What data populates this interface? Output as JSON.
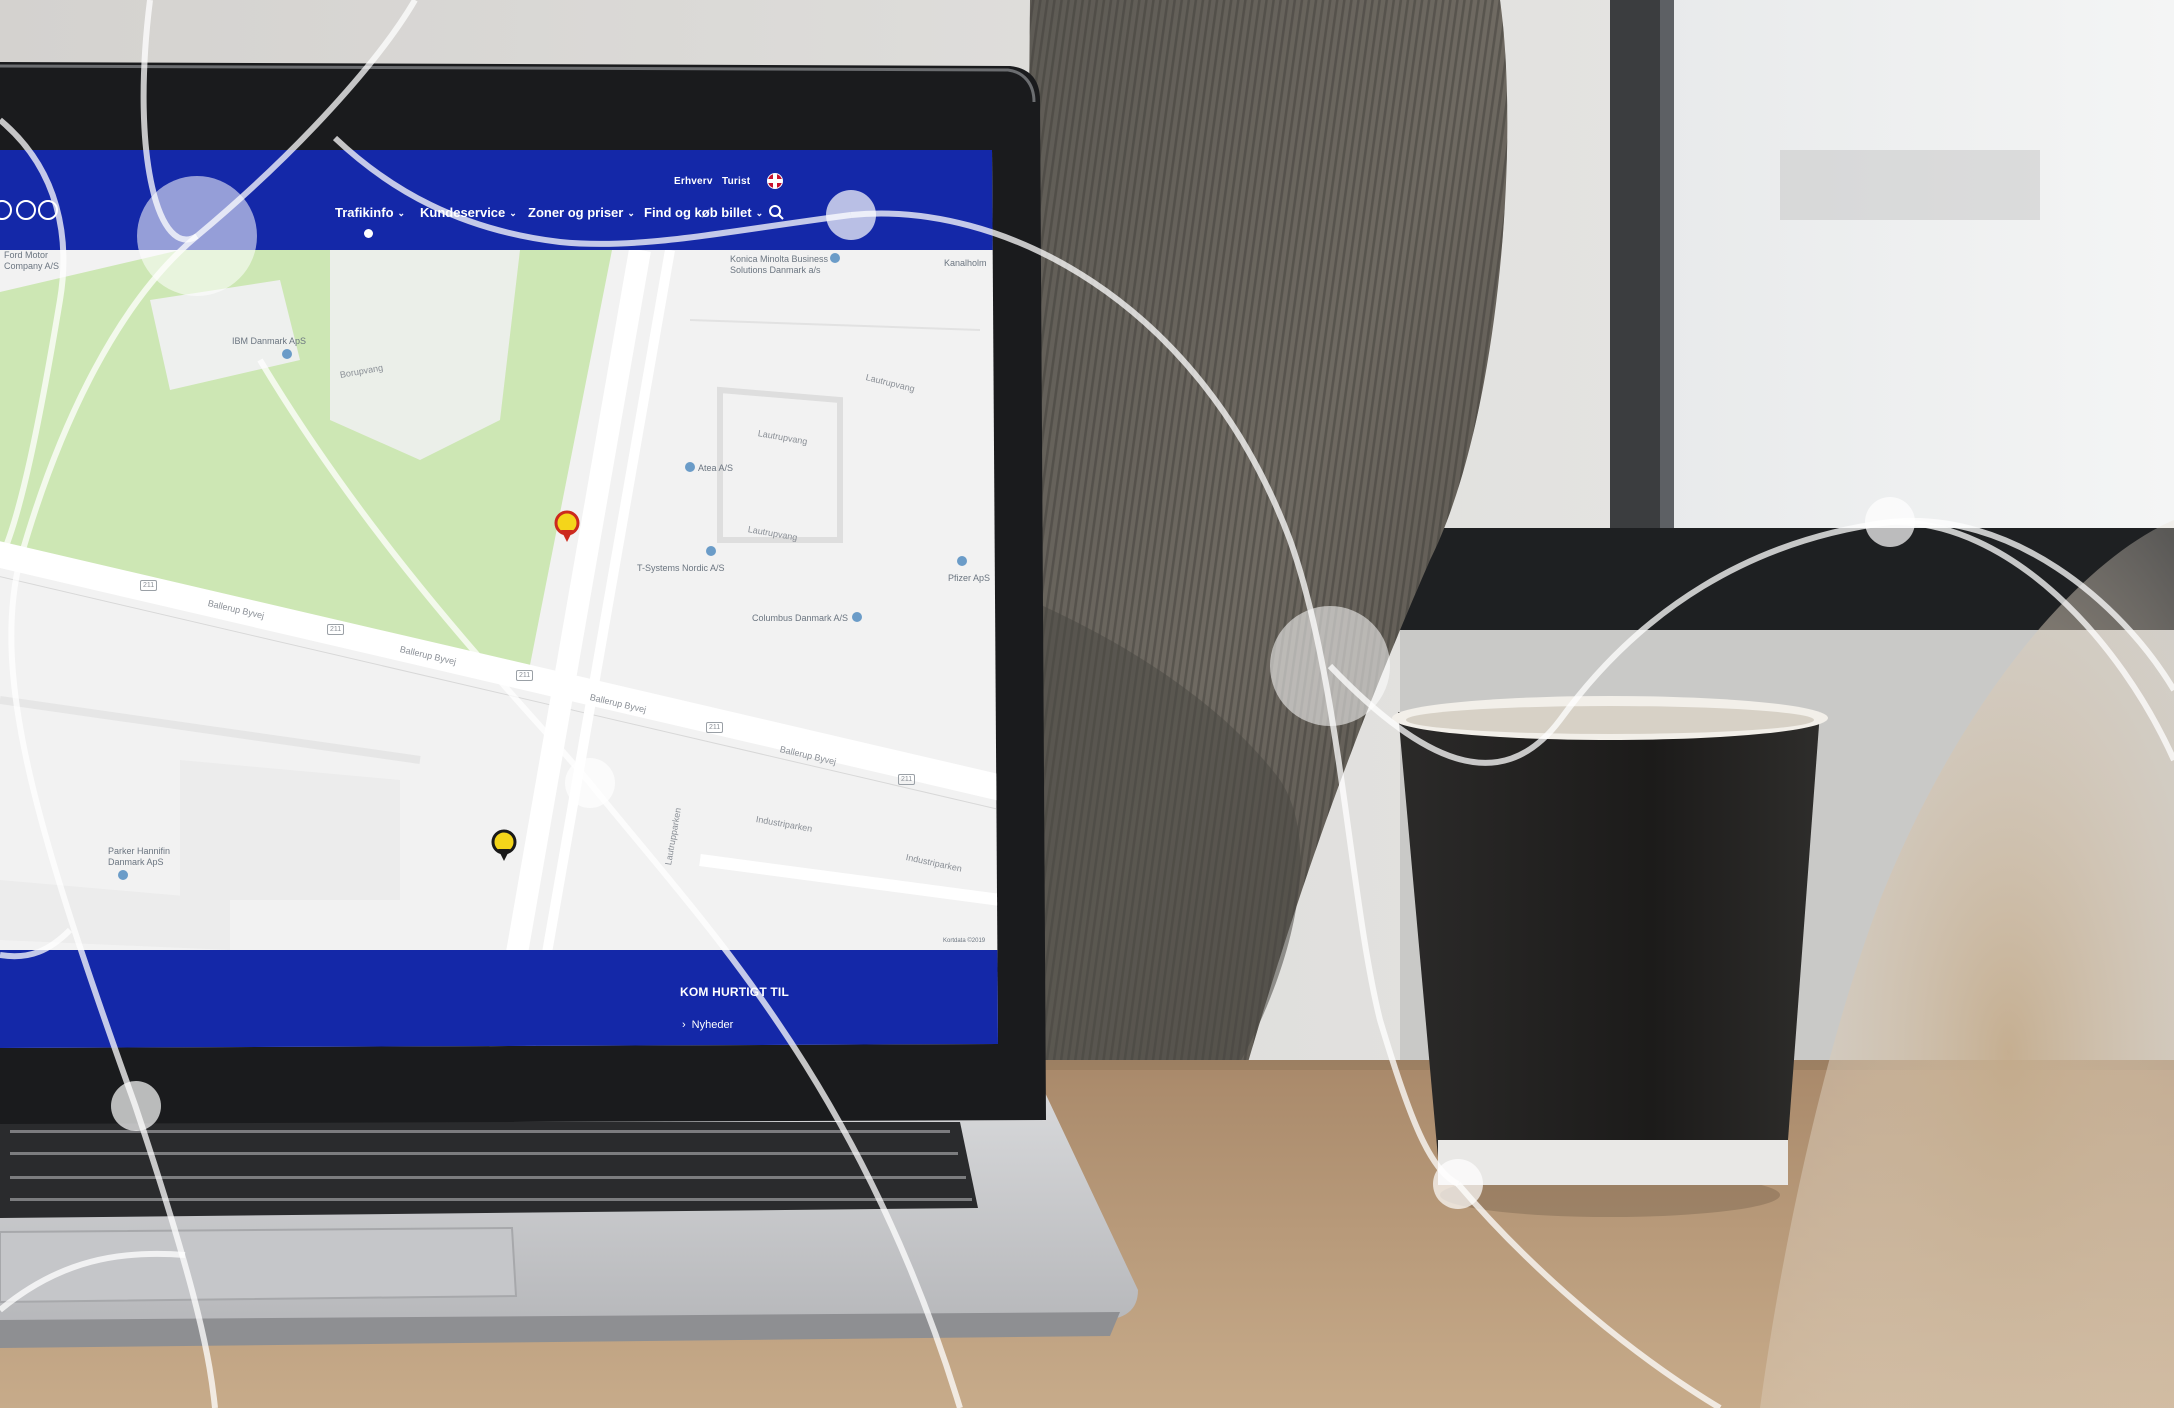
{
  "website": {
    "utility_links": [
      "Erhverv",
      "Turist"
    ],
    "language_flag_icon": "uk-flag-icon",
    "nav": [
      {
        "label": "Trafikinfo",
        "icon": "chevron-down-icon"
      },
      {
        "label": "Kundeservice",
        "icon": "chevron-down-icon"
      },
      {
        "label": "Zoner og priser",
        "icon": "chevron-down-icon"
      },
      {
        "label": "Find og køb billet",
        "icon": "chevron-down-icon"
      }
    ],
    "search_icon": "search-icon",
    "footer": {
      "title": "KOM HURTIGT TIL",
      "link": "Nyheder"
    },
    "brand_color": "#1428a8"
  },
  "map": {
    "places": [
      {
        "label": "Ford Motor\nCompany A/S"
      },
      {
        "label": "IBM Danmark ApS"
      },
      {
        "label": "Konica Minolta Business\nSolutions Danmark a/s"
      },
      {
        "label": "Kanalholm"
      },
      {
        "label": "Atea A/S"
      },
      {
        "label": "T-Systems Nordic A/S"
      },
      {
        "label": "Columbus Danmark A/S"
      },
      {
        "label": "Pfizer ApS"
      },
      {
        "label": "Parker Hannifin\nDanmark ApS"
      }
    ],
    "streets": [
      "Ballerup Byvej",
      "Ballerup Byvej",
      "Ballerup Byvej",
      "Ballerup Byvej",
      "Lautrupvang",
      "Lautrupvang",
      "Lautrupvang",
      "Lautrupparken",
      "Industriparken",
      "Industriparken",
      "Borupvang"
    ],
    "route_numbers": [
      "211",
      "211",
      "211",
      "211",
      "211"
    ],
    "attribution": "Kortdata ©2019",
    "colors": {
      "park": "#cde7b4",
      "land": "#f2f2f2"
    }
  }
}
